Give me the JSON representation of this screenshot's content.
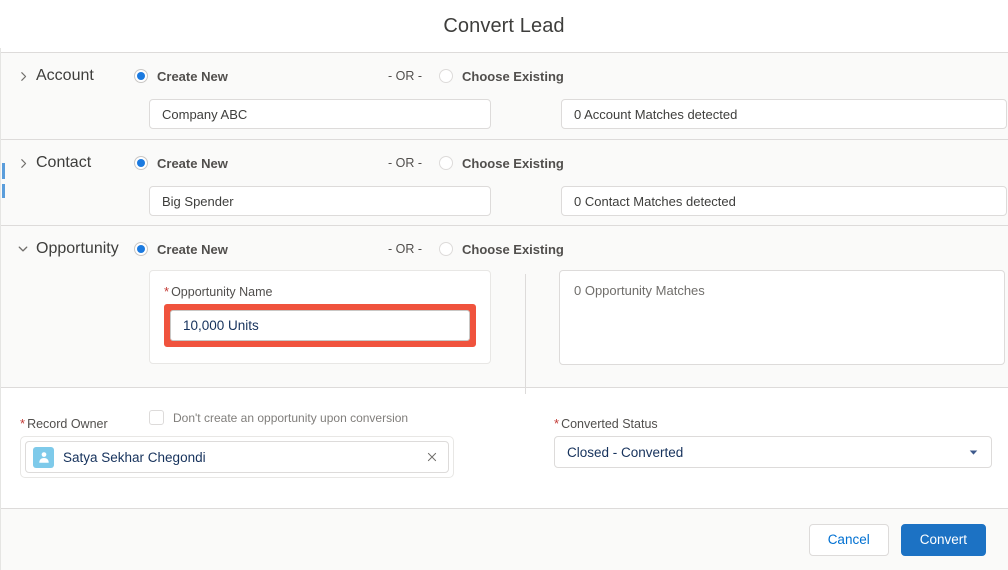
{
  "header": {
    "title": "Convert Lead"
  },
  "sections": [
    {
      "key": "account",
      "name": "Account",
      "expanded": false,
      "chevron_icon": "chevron-right-icon",
      "create_new_label": "Create New",
      "create_new_selected": true,
      "or_label": "- OR -",
      "choose_existing_label": "Choose Existing",
      "choose_existing_selected": false,
      "new_value": "Company ABC",
      "match_value": "0 Account Matches detected"
    },
    {
      "key": "contact",
      "name": "Contact",
      "expanded": false,
      "chevron_icon": "chevron-right-icon",
      "create_new_label": "Create New",
      "create_new_selected": true,
      "or_label": "- OR -",
      "choose_existing_label": "Choose Existing",
      "choose_existing_selected": false,
      "new_value": "Big Spender",
      "match_value": "0 Contact Matches detected"
    }
  ],
  "opportunity": {
    "name": "Opportunity",
    "expanded": true,
    "chevron_icon": "chevron-down-icon",
    "create_new_label": "Create New",
    "create_new_selected": true,
    "or_label": "- OR -",
    "choose_existing_label": "Choose Existing",
    "choose_existing_selected": false,
    "field_label": "Opportunity Name",
    "field_required_marker": "*",
    "field_value": "10,000 Units",
    "field_highlighted": true,
    "highlight_color": "#f0533d",
    "checkbox_label": "Don't create an opportunity upon conversion",
    "checkbox_checked": false,
    "match_value": "0 Opportunity Matches"
  },
  "record_owner": {
    "label": "Record Owner",
    "required_marker": "*",
    "value": "Satya Sekhar Chegondi",
    "avatar_icon": "user-avatar-icon",
    "clear_icon": "close-icon"
  },
  "converted_status": {
    "label": "Converted Status",
    "required_marker": "*",
    "value": "Closed - Converted",
    "caret_icon": "chevron-down-icon"
  },
  "footer": {
    "cancel_label": "Cancel",
    "convert_label": "Convert"
  },
  "colors": {
    "brand_blue": "#1c72c4",
    "radio_blue": "#1b7ae0",
    "link_blue": "#0070d2",
    "highlight_red": "#f0533d",
    "required_red": "#c23934",
    "section_bg": "#fafaf9",
    "border": "#dddbda",
    "avatar_blue": "#7ecaea"
  }
}
